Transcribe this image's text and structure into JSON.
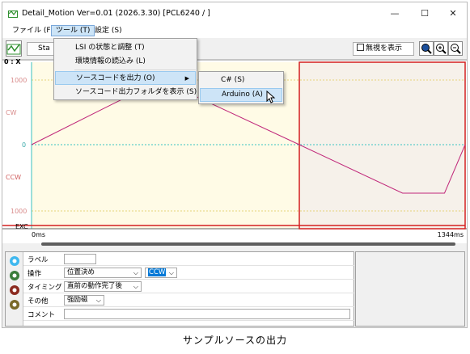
{
  "window": {
    "title": "Detail_Motion  Ver=0.01  (2026.3.30)  [PCL6240 / ]",
    "minimize": "—",
    "maximize": "☐",
    "close": "✕"
  },
  "menubar": {
    "file": "ファイル (F)",
    "tool": "ツール (T)",
    "settings": "設定 (S)"
  },
  "tool_menu": {
    "items": [
      {
        "label": "LSI の状態と調整 (T)"
      },
      {
        "label": "環境情報の読込み (L)"
      },
      {
        "label": "ソースコードを出力 (O)",
        "has_submenu": true,
        "submenu_arrow": "▶"
      },
      {
        "label": "ソースコード出力フォルダを表示 (S)"
      }
    ]
  },
  "source_submenu": {
    "items": [
      {
        "label": "C# (S)"
      },
      {
        "label": "Arduino (A)"
      }
    ]
  },
  "toolbar": {
    "start_label": "Sta",
    "ignore_label": "無視を表示",
    "ignore_checked": false
  },
  "chart_data": {
    "type": "line",
    "ylabels": [
      "0 : X",
      "1000",
      "CW",
      "0",
      "CCW",
      "1000",
      "EXC"
    ],
    "xlabels": [
      "0ms",
      "1344ms"
    ],
    "series": [
      {
        "x": [
          0,
          400,
          830,
          1150,
          1280,
          1344
        ],
        "y": [
          0,
          1000,
          0,
          -750,
          -750,
          0
        ],
        "color": "#c0287a"
      }
    ],
    "xlim": [
      0,
      1344
    ],
    "ylim": [
      -1000,
      1000
    ],
    "highlight_from_ms": 830,
    "colors": {
      "past_region": "#fffbe6",
      "future_region": "#f6f1ea",
      "red_frame": "#d42020",
      "dotted": "#e6d37a",
      "zero_line": "#3ac3c3",
      "cyan_divider": "#39c0c0"
    }
  },
  "props": {
    "rows": [
      {
        "label": "ラベル",
        "value": ""
      },
      {
        "label": "操作",
        "value": "位置決め",
        "value2": "CCW"
      },
      {
        "label": "タイミング",
        "value": "直前の動作完了後"
      },
      {
        "label": "その他",
        "value": "強励磁"
      },
      {
        "label": "コメント",
        "value": ""
      }
    ],
    "select_arrow": "⌵"
  },
  "caption": "サンプルソースの出力"
}
